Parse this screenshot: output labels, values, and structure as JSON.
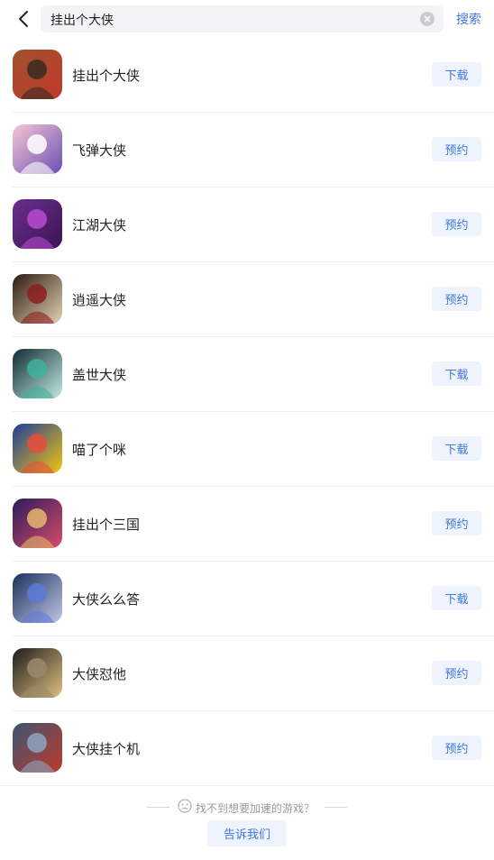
{
  "search": {
    "query": "挂出个大侠",
    "button_label": "搜索"
  },
  "results": [
    {
      "name": "挂出个大侠",
      "action": "下载",
      "icon": "game-icon-ninja",
      "colors": [
        "#a0522d",
        "#3a2a22",
        "#c0392b"
      ]
    },
    {
      "name": "飞弹大侠",
      "action": "预约",
      "icon": "game-icon-bear",
      "colors": [
        "#f6c6d6",
        "#ffffff",
        "#6a4fb3"
      ]
    },
    {
      "name": "江湖大侠",
      "action": "预约",
      "icon": "game-icon-purple-monster",
      "colors": [
        "#6b2f8f",
        "#b84ad1",
        "#3a1450"
      ]
    },
    {
      "name": "逍遥大侠",
      "action": "预约",
      "icon": "game-icon-swordsman",
      "colors": [
        "#2d1a12",
        "#8b1e1e",
        "#e5d3b3"
      ]
    },
    {
      "name": "盖世大侠",
      "action": "下载",
      "icon": "game-icon-moon-fighter",
      "colors": [
        "#0f2c33",
        "#3cb39b",
        "#c4e9e0"
      ]
    },
    {
      "name": "喵了个咪",
      "action": "下载",
      "icon": "game-icon-blue-robot",
      "colors": [
        "#1f3e9b",
        "#e74c3c",
        "#f1c40f"
      ]
    },
    {
      "name": "挂出个三国",
      "action": "预约",
      "icon": "game-icon-princess",
      "colors": [
        "#2b1b5a",
        "#e6b76e",
        "#d84b6b"
      ]
    },
    {
      "name": "大侠么么答",
      "action": "下载",
      "icon": "game-icon-dark-elf",
      "colors": [
        "#1b2e5a",
        "#5d7bd6",
        "#c0c7e8"
      ]
    },
    {
      "name": "大侠怼他",
      "action": "预约",
      "icon": "game-icon-warrior",
      "colors": [
        "#1c1c1c",
        "#9c8a6d",
        "#e0c080"
      ]
    },
    {
      "name": "大侠挂个机",
      "action": "预约",
      "icon": "game-icon-hatted-hero",
      "colors": [
        "#3c5572",
        "#8aa6c0",
        "#c0392b"
      ]
    }
  ],
  "footer": {
    "prompt": "找不到想要加速的游戏？",
    "button_label": "告诉我们"
  },
  "theme": {
    "accent": "#3f78e0",
    "button_bg": "#eef3fd"
  }
}
